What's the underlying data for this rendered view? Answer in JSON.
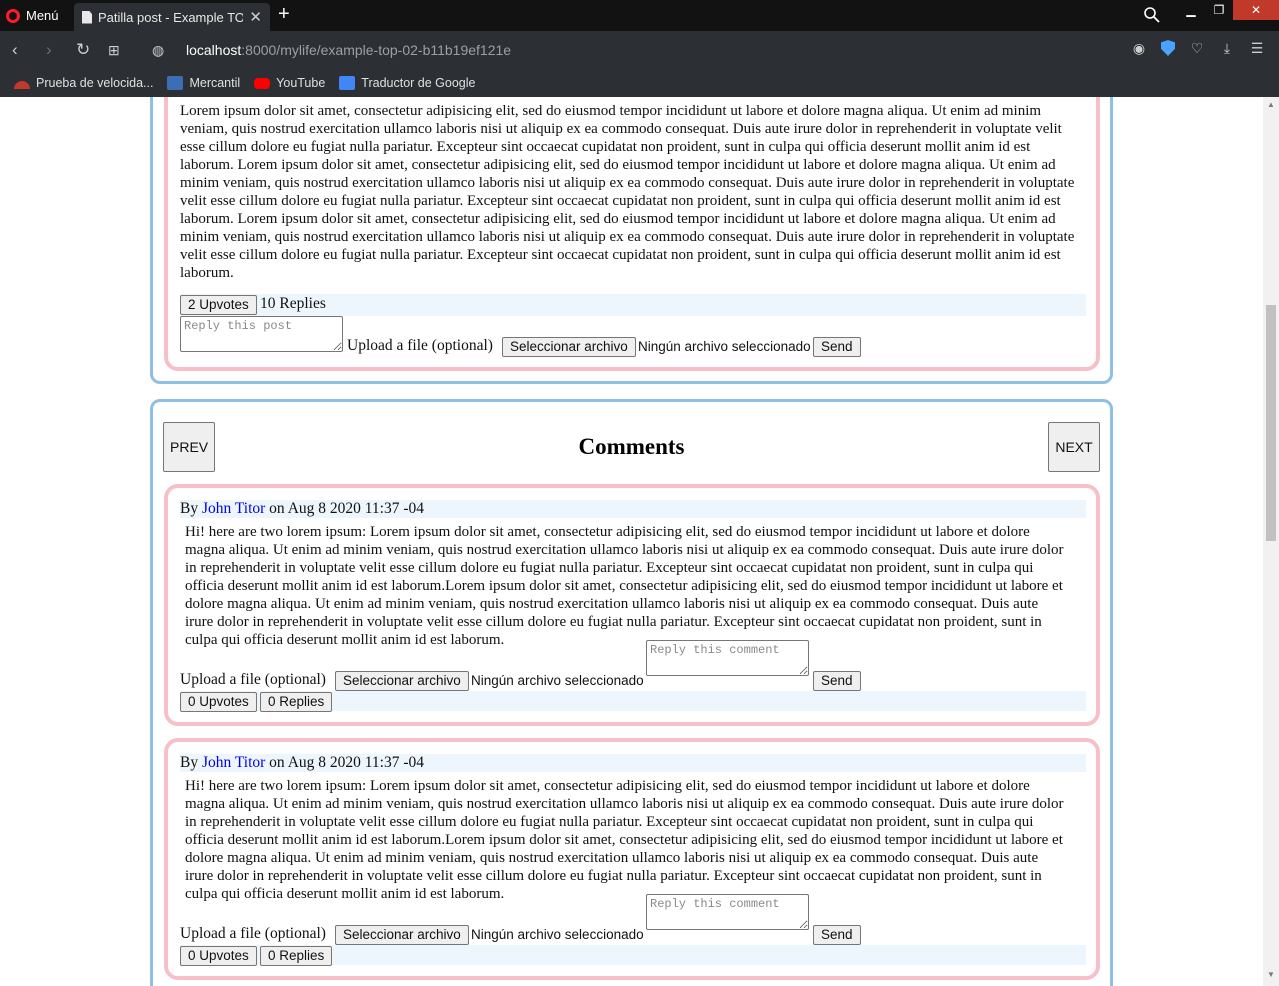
{
  "browser": {
    "menu_label": "Menú",
    "tab_title": "Patilla post - Example TOP",
    "url_host": "localhost",
    "url_rest": ":8000/mylife/example-top-02-b11b19ef121e",
    "bookmarks": [
      {
        "label": "Prueba de velocida...",
        "color": "#c0392b"
      },
      {
        "label": "Mercantil",
        "color": "#3a6fb5"
      },
      {
        "label": "YouTube",
        "color": "#ff0000"
      },
      {
        "label": "Traductor de Google",
        "color": "#4285f4"
      }
    ]
  },
  "post": {
    "text": "Lorem ipsum dolor sit amet, consectetur adipisicing elit, sed do eiusmod tempor incididunt ut labore et dolore magna aliqua. Ut enim ad minim veniam, quis nostrud exercitation ullamco laboris nisi ut aliquip ex ea commodo consequat. Duis aute irure dolor in reprehenderit in voluptate velit esse cillum dolore eu fugiat nulla pariatur. Excepteur sint occaecat cupidatat non proident, sunt in culpa qui officia deserunt mollit anim id est laborum. Lorem ipsum dolor sit amet, consectetur adipisicing elit, sed do eiusmod tempor incididunt ut labore et dolore magna aliqua. Ut enim ad minim veniam, quis nostrud exercitation ullamco laboris nisi ut aliquip ex ea commodo consequat. Duis aute irure dolor in reprehenderit in voluptate velit esse cillum dolore eu fugiat nulla pariatur. Excepteur sint occaecat cupidatat non proident, sunt in culpa qui officia deserunt mollit anim id est laborum. Lorem ipsum dolor sit amet, consectetur adipisicing elit, sed do eiusmod tempor incididunt ut labore et dolore magna aliqua. Ut enim ad minim veniam, quis nostrud exercitation ullamco laboris nisi ut aliquip ex ea commodo consequat. Duis aute irure dolor in reprehenderit in voluptate velit esse cillum dolore eu fugiat nulla pariatur. Excepteur sint occaecat cupidatat non proident, sunt in culpa qui officia deserunt mollit anim id est laborum.",
    "upvotes_label": "2 Upvotes",
    "replies_label": "10 Replies",
    "reply_placeholder": "Reply this post",
    "upload_label": "Upload a file (optional)",
    "choose_file_label": "Seleccionar archivo",
    "no_file_label": "Ningún archivo seleccionado",
    "send_label": "Send"
  },
  "comments_section": {
    "title": "Comments",
    "prev_label": "PREV",
    "next_label": "NEXT"
  },
  "comments": [
    {
      "by": "By",
      "author": "John Titor",
      "date": "on Aug 8 2020 11:37 -04",
      "text": "Hi! here are two lorem ipsum: Lorem ipsum dolor sit amet, consectetur adipisicing elit, sed do eiusmod tempor incididunt ut labore et dolore magna aliqua. Ut enim ad minim veniam, quis nostrud exercitation ullamco laboris nisi ut aliquip ex ea commodo consequat. Duis aute irure dolor in reprehenderit in voluptate velit esse cillum dolore eu fugiat nulla pariatur. Excepteur sint occaecat cupidatat non proident, sunt in culpa qui officia deserunt mollit anim id est laborum.Lorem ipsum dolor sit amet, consectetur adipisicing elit, sed do eiusmod tempor incididunt ut labore et dolore magna aliqua. Ut enim ad minim veniam, quis nostrud exercitation ullamco laboris nisi ut aliquip ex ea commodo consequat. Duis aute irure dolor in reprehenderit in voluptate velit esse cillum dolore eu fugiat nulla pariatur. Excepteur sint occaecat cupidatat non proident, sunt in culpa qui officia deserunt mollit anim id est laborum.",
      "upload_label": "Upload a file (optional)",
      "choose_file_label": "Seleccionar archivo",
      "no_file_label": "Ningún archivo seleccionado",
      "reply_placeholder": "Reply this comment",
      "send_label": "Send",
      "upvotes_label": "0 Upvotes",
      "replies_label": "0 Replies"
    },
    {
      "by": "By",
      "author": "John Titor",
      "date": "on Aug 8 2020 11:37 -04",
      "text": "Hi! here are two lorem ipsum: Lorem ipsum dolor sit amet, consectetur adipisicing elit, sed do eiusmod tempor incididunt ut labore et dolore magna aliqua. Ut enim ad minim veniam, quis nostrud exercitation ullamco laboris nisi ut aliquip ex ea commodo consequat. Duis aute irure dolor in reprehenderit in voluptate velit esse cillum dolore eu fugiat nulla pariatur. Excepteur sint occaecat cupidatat non proident, sunt in culpa qui officia deserunt mollit anim id est laborum.Lorem ipsum dolor sit amet, consectetur adipisicing elit, sed do eiusmod tempor incididunt ut labore et dolore magna aliqua. Ut enim ad minim veniam, quis nostrud exercitation ullamco laboris nisi ut aliquip ex ea commodo consequat. Duis aute irure dolor in reprehenderit in voluptate velit esse cillum dolore eu fugiat nulla pariatur. Excepteur sint occaecat cupidatat non proident, sunt in culpa qui officia deserunt mollit anim id est laborum.",
      "upload_label": "Upload a file (optional)",
      "choose_file_label": "Seleccionar archivo",
      "no_file_label": "Ningún archivo seleccionado",
      "reply_placeholder": "Reply this comment",
      "send_label": "Send",
      "upvotes_label": "0 Upvotes",
      "replies_label": "0 Replies"
    }
  ]
}
